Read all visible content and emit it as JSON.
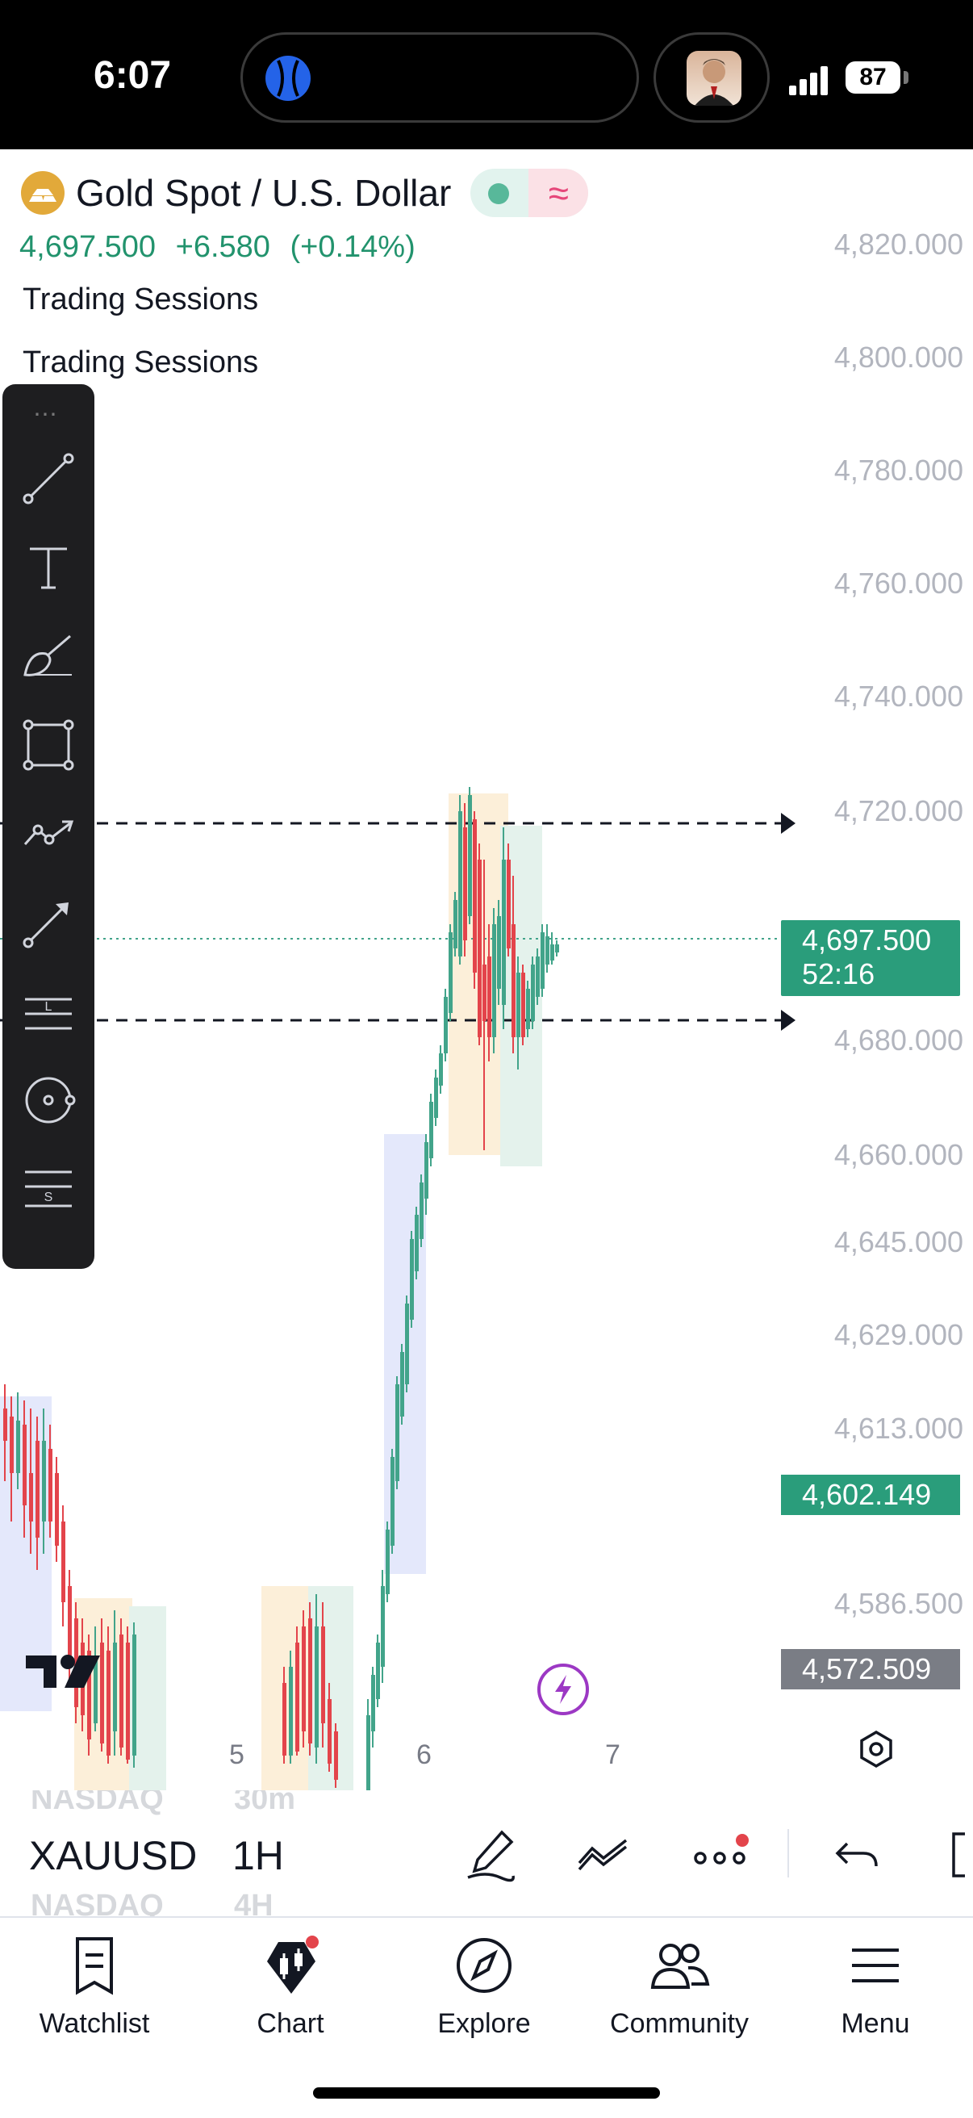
{
  "status_bar": {
    "time": "6:07",
    "battery": "87"
  },
  "header": {
    "symbol_name": "Gold Spot / U.S. Dollar",
    "last_price": "4,697.500",
    "change": "+6.580",
    "change_percent": "(+0.14%)",
    "indicators": [
      "Trading Sessions",
      "Trading Sessions"
    ]
  },
  "price_scale": [
    "4,820.000",
    "4,800.000",
    "4,780.000",
    "4,760.000",
    "4,740.000",
    "4,720.000",
    "4,680.000",
    "4,660.000",
    "4,645.000",
    "4,629.000",
    "4,613.000",
    "4,586.500"
  ],
  "price_tags": {
    "current_price": "4,697.500",
    "countdown": "52:16",
    "tag_2": "4,602.149",
    "tag_3": "4,572.509"
  },
  "time_axis": [
    "5",
    "6",
    "7"
  ],
  "colors": {
    "up": "#42a48a",
    "down": "#e3444b",
    "accent": "#2a9d7b",
    "flash": "#9c38c4"
  },
  "drawing_tools": [
    "trend-line",
    "text",
    "brush",
    "rectangle",
    "path",
    "arrow",
    "long-position",
    "circle",
    "short-position"
  ],
  "toolbar": {
    "symbol": "XAUUSD",
    "interval": "1H",
    "ghost_above_symbol": "NASDAQ",
    "ghost_above_interval": "30m",
    "ghost_below_symbol": "NASDAQ",
    "ghost_below_interval": "4H"
  },
  "tabs": [
    {
      "label": "Watchlist",
      "icon": "watchlist-icon"
    },
    {
      "label": "Chart",
      "icon": "chart-icon"
    },
    {
      "label": "Explore",
      "icon": "compass-icon"
    },
    {
      "label": "Community",
      "icon": "community-icon"
    },
    {
      "label": "Menu",
      "icon": "menu-icon"
    }
  ]
}
